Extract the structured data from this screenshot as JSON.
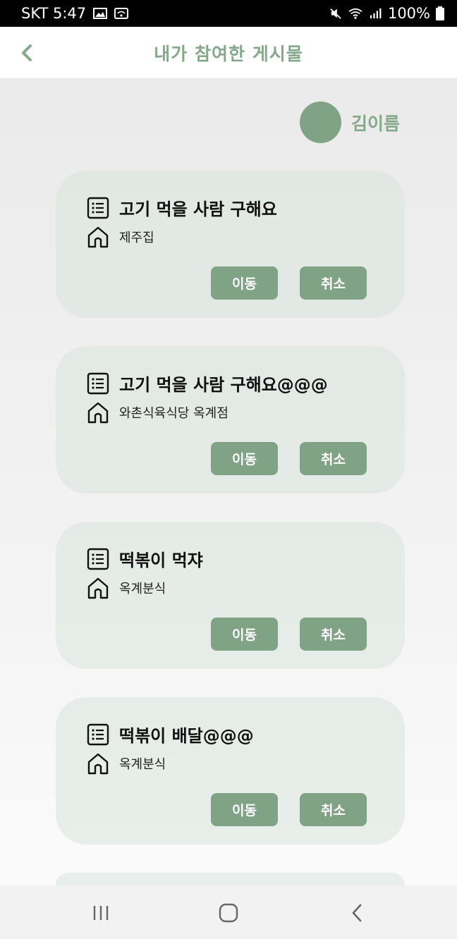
{
  "status_bar": {
    "carrier_time": "SKT 5:47",
    "battery": "100%"
  },
  "header": {
    "title": "내가 참여한 게시물",
    "back_icon": "chevron-left-icon"
  },
  "profile": {
    "name": "김이름",
    "avatar_color": "#7fa384"
  },
  "colors": {
    "accent": "#7fa384",
    "accent_text": "#84a98a",
    "card_bg": "#e3ebe4"
  },
  "cards": [
    {
      "title": "고기 먹을 사람 구해요",
      "place": "제주집",
      "move_label": "이동",
      "cancel_label": "취소"
    },
    {
      "title": "고기 먹을 사람 구해요@@@",
      "place": "와촌식육식당 옥계점",
      "move_label": "이동",
      "cancel_label": "취소"
    },
    {
      "title": "떡볶이 먹쟈",
      "place": "옥계분식",
      "move_label": "이동",
      "cancel_label": "취소"
    },
    {
      "title": "떡볶이 배달@@@",
      "place": "옥계분식",
      "move_label": "이동",
      "cancel_label": "취소"
    }
  ],
  "nav": {
    "recents_icon": "recent-apps-icon",
    "home_icon": "home-icon",
    "back_icon": "back-icon"
  }
}
